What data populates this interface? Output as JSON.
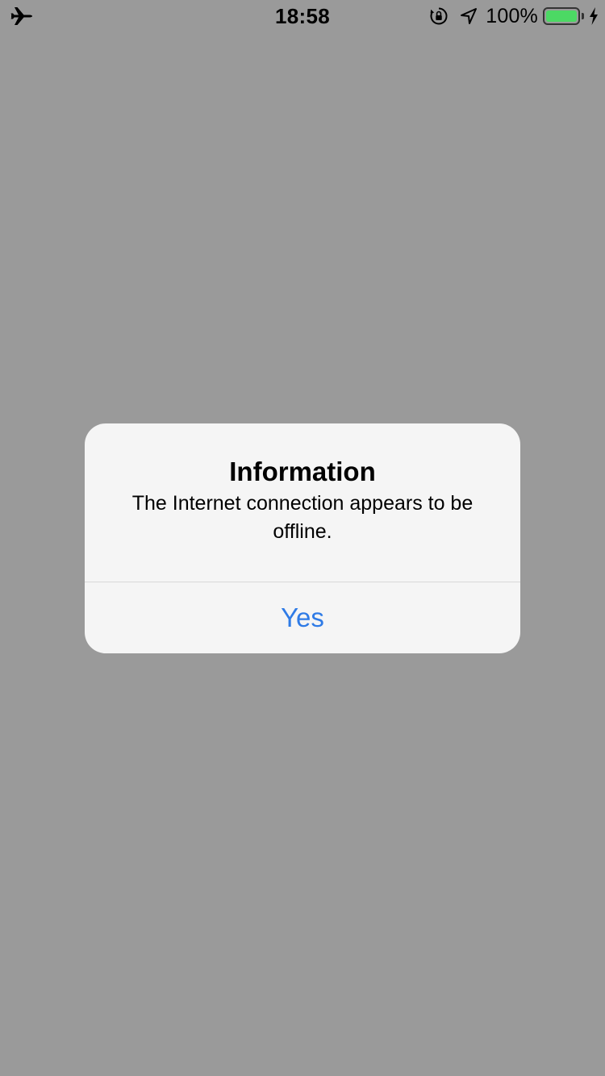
{
  "status_bar": {
    "time": "18:58",
    "battery_percent": "100%",
    "battery_level": 1.0,
    "icons": [
      "airplane-icon",
      "orientation-lock-icon",
      "location-arrow-icon",
      "battery-icon",
      "charging-bolt-icon"
    ]
  },
  "alert": {
    "title": "Information",
    "message": "The Internet connection appears to be offline.",
    "button_label": "Yes"
  },
  "colors": {
    "background_dim": "#9a9a9a",
    "alert_background": "#f8f8f8",
    "button_blue": "#2f7be6",
    "battery_green": "#4cd964"
  }
}
